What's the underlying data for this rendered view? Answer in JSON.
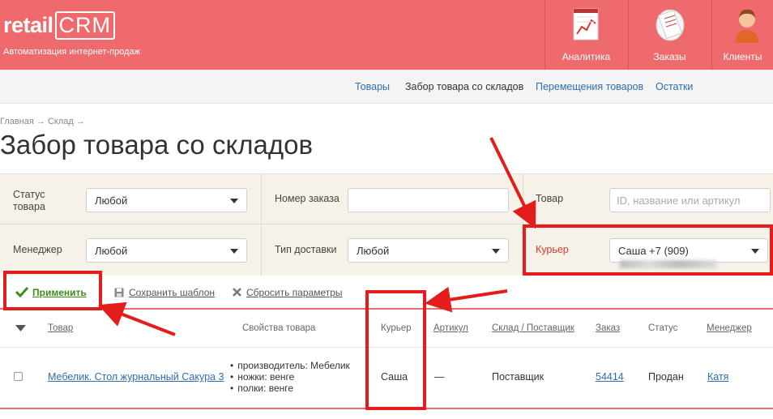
{
  "header": {
    "logo_text": "retail",
    "logo_crm": "CRM",
    "tagline": "Автоматизация интернет-продаж",
    "nav": [
      {
        "label": "Аналитика",
        "icon": "analytics-chart-icon"
      },
      {
        "label": "Заказы",
        "icon": "orders-receipt-icon"
      },
      {
        "label": "Клиенты",
        "icon": "clients-person-icon"
      }
    ]
  },
  "subnav": {
    "items": [
      "Товары",
      "Забор товара со складов",
      "Перемещения товаров",
      "Остатки"
    ],
    "active_index": 1
  },
  "breadcrumb": "Главная → Склад →",
  "page_title": "Забор товара со складов",
  "filters": {
    "status_label": "Статус товара",
    "status_value": "Любой",
    "order_number_label": "Номер заказа",
    "order_number_value": "",
    "product_label": "Товар",
    "product_placeholder": "ID, название или артикул",
    "manager_label": "Менеджер",
    "manager_value": "Любой",
    "delivery_label": "Тип доставки",
    "delivery_value": "Любой",
    "courier_label": "Курьер",
    "courier_value": "Саша +7 (909)"
  },
  "actions": {
    "apply": "Применить",
    "save_template": "Сохранить шаблон",
    "reset": "Сбросить параметры"
  },
  "table": {
    "columns": [
      "Товар",
      "Свойства товара",
      "Курьер",
      "Артикул",
      "Склад / Поставщик",
      "Заказ",
      "Статус",
      "Менеджер"
    ],
    "rows": [
      {
        "product": "Мебелик. Стол журнальный Сакура 3",
        "properties": [
          "производитель: Мебелик",
          "ножки: венге",
          "полки: венге"
        ],
        "courier": "Саша",
        "article": "—",
        "warehouse": "Поставщик",
        "order": "54414",
        "status": "Продан",
        "manager": "Катя"
      }
    ]
  },
  "colors": {
    "header_bg": "#ee6a6c",
    "filter_bg": "#f6f2e9",
    "link": "#2f6eaf",
    "apply_green": "#3b8d1c",
    "annotation_red": "#e41c1c"
  }
}
